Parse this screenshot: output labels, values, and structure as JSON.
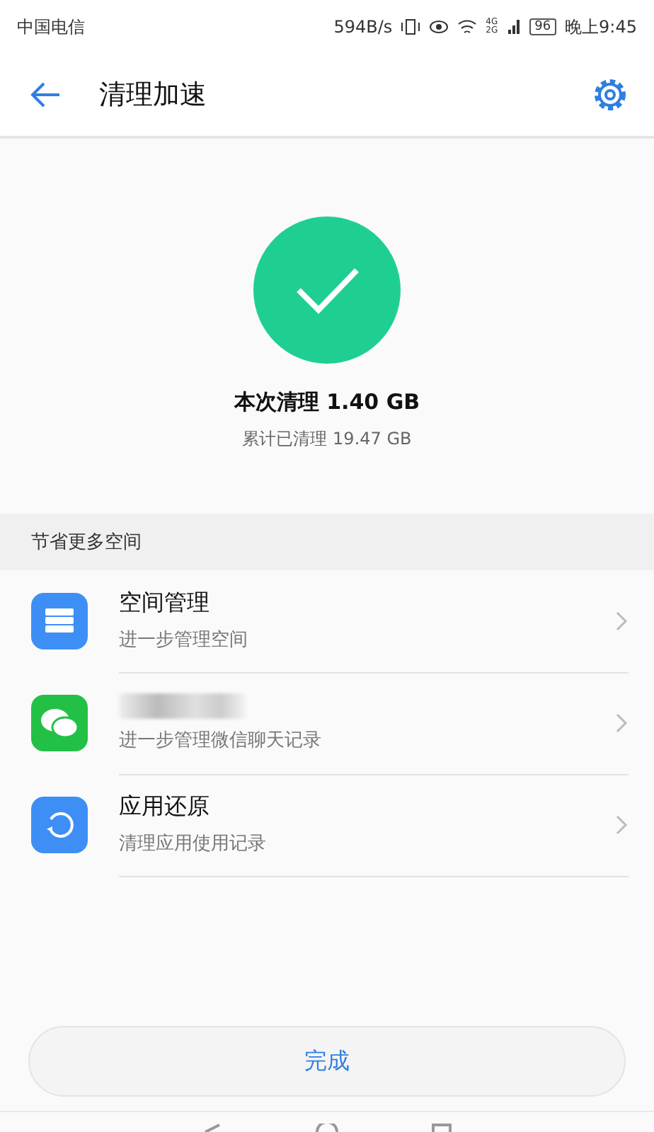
{
  "status_bar": {
    "carrier": "中国电信",
    "speed": "594B/s",
    "signal_labels": [
      "4G",
      "2G"
    ],
    "battery": "96",
    "time": "晚上9:45"
  },
  "header": {
    "title": "清理加速"
  },
  "result": {
    "main": "本次清理 1.40 GB",
    "total": "累计已清理 19.47 GB"
  },
  "section": {
    "title": "节省更多空间"
  },
  "items": [
    {
      "kind": "storage",
      "title": "空间管理",
      "subtitle": "进一步管理空间"
    },
    {
      "kind": "chat",
      "subtitle": "进一步管理微信聊天记录"
    },
    {
      "kind": "restore",
      "title": "应用还原",
      "subtitle": "清理应用使用记录"
    }
  ],
  "done_button": "完成"
}
